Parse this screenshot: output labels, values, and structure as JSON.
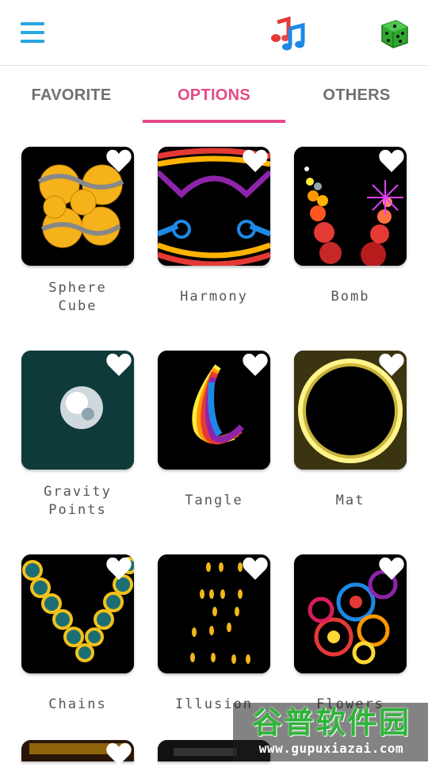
{
  "header": {
    "menu_icon": "hamburger-menu-icon",
    "logo_icon": "music-notes-icon",
    "random_icon": "dice-icon",
    "accent": "#29a7e1",
    "dice_color": "#2ea82f"
  },
  "tabs": [
    {
      "label": "FAVORITE",
      "active": false
    },
    {
      "label": "OPTIONS",
      "active": true
    },
    {
      "label": "OTHERS",
      "active": false
    }
  ],
  "active_tab_color": "#e44a86",
  "visualizers": [
    {
      "name": "Sphere\nCube",
      "favorite_icon": "heart-icon"
    },
    {
      "name": "Harmony",
      "favorite_icon": "heart-icon"
    },
    {
      "name": "Bomb",
      "favorite_icon": "heart-icon"
    },
    {
      "name": "Gravity\nPoints",
      "favorite_icon": "heart-icon"
    },
    {
      "name": "Tangle",
      "favorite_icon": "heart-icon"
    },
    {
      "name": "Mat",
      "favorite_icon": "heart-icon"
    },
    {
      "name": "Chains",
      "favorite_icon": "heart-icon"
    },
    {
      "name": "Illusion",
      "favorite_icon": "heart-icon"
    },
    {
      "name": "Flowers",
      "favorite_icon": "heart-icon"
    }
  ],
  "watermark": {
    "title": "谷普软件园",
    "url": "www.gupuxiazai.com"
  }
}
